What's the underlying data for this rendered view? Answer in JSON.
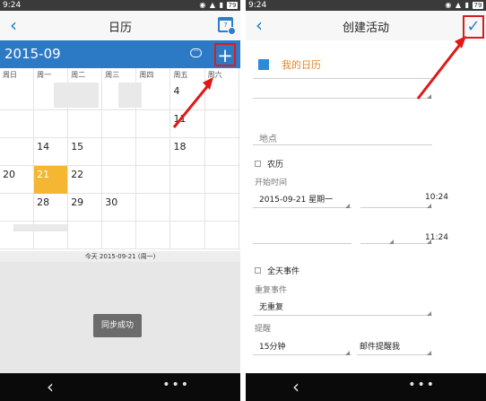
{
  "status": {
    "time_left": "9:24",
    "time_right": "9:24",
    "battery": "79"
  },
  "left": {
    "title": "日历",
    "month": "2015-09",
    "weekdays": [
      "周日",
      "周一",
      "周二",
      "周三",
      "周四",
      "周五",
      "周六"
    ],
    "rows": [
      [
        "",
        "",
        "",
        "",
        "",
        "4",
        ""
      ],
      [
        "",
        "",
        "",
        "",
        "",
        "11",
        ""
      ],
      [
        "",
        "14",
        "15",
        "",
        "",
        "18",
        ""
      ],
      [
        "20",
        "21",
        "22",
        "",
        "",
        "",
        ""
      ],
      [
        "",
        "28",
        "29",
        "30",
        "",
        "",
        ""
      ],
      [
        "",
        "",
        "",
        "",
        "",
        "",
        ""
      ]
    ],
    "today_label": "今天 2015-09-21 (周一)",
    "toast": "同步成功"
  },
  "right": {
    "title": "创建活动",
    "calendar_name": "我的日历",
    "location_placeholder": "地点",
    "lunar_label": "农历",
    "start_label": "开始时间",
    "start_date": "2015-09-21 星期一",
    "start_time": "10:24",
    "end_time": "11:24",
    "allday_label": "全天事件",
    "repeat_label": "重复事件",
    "repeat_value": "无重复",
    "reminder_label": "提醒",
    "reminder_value": "15分钟",
    "reminder_type": "邮件提醒我"
  },
  "colors": {
    "accent": "#2c79c5",
    "today": "#f5b731",
    "highlight": "#d61e1e",
    "calendar_name": "#e1862a"
  }
}
